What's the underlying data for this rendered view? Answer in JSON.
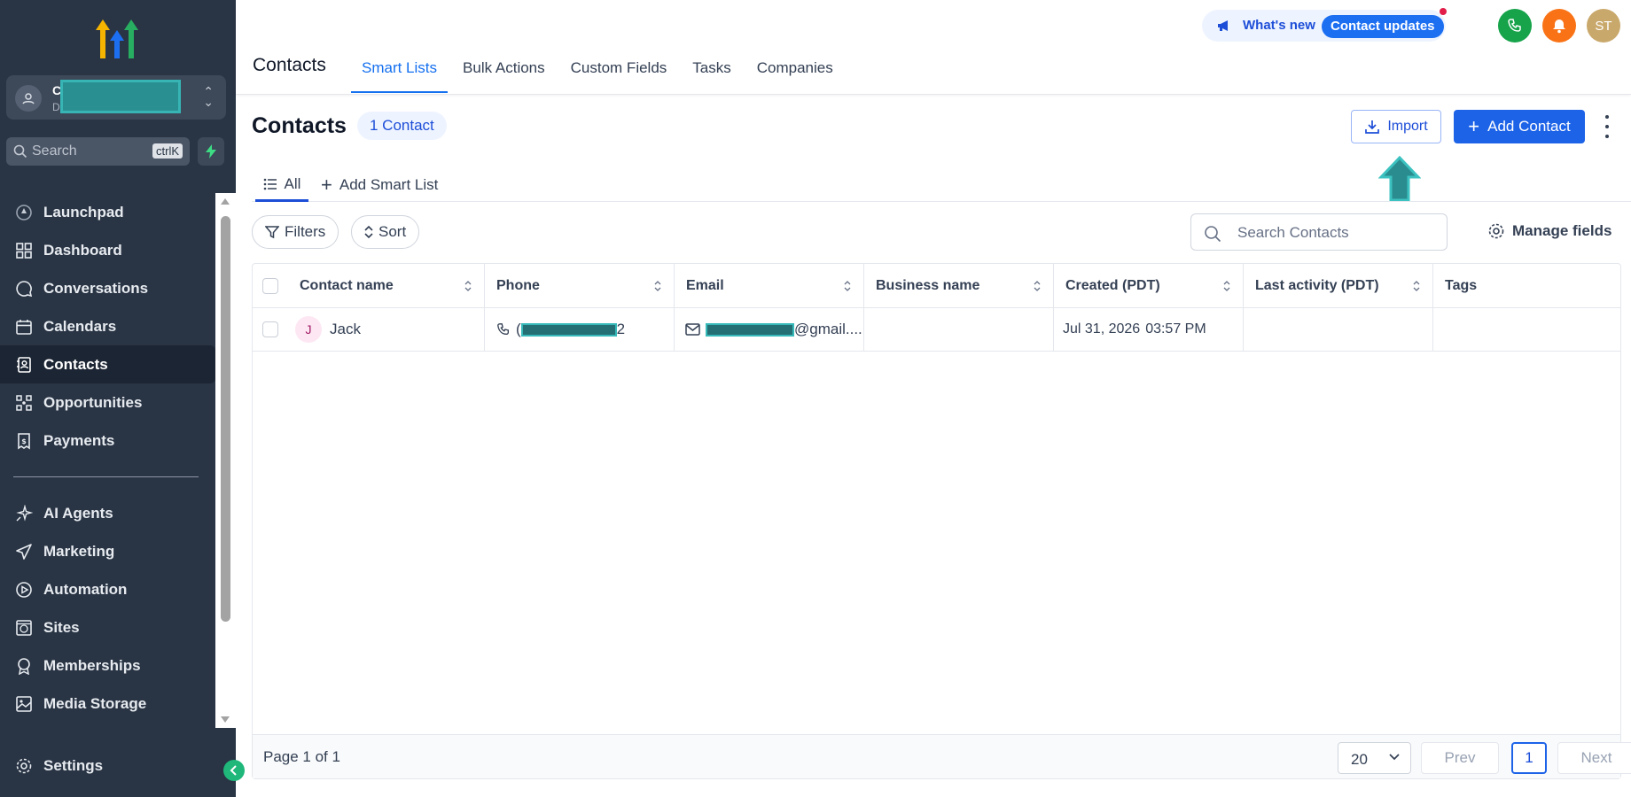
{
  "sidebar": {
    "account_initial": "C",
    "account_sub": "D",
    "search_placeholder": "Search",
    "search_shortcut": "ctrlK",
    "items": [
      {
        "label": "Launchpad",
        "icon": "launchpad-icon"
      },
      {
        "label": "Dashboard",
        "icon": "dashboard-icon"
      },
      {
        "label": "Conversations",
        "icon": "chat-icon"
      },
      {
        "label": "Calendars",
        "icon": "calendar-icon"
      },
      {
        "label": "Contacts",
        "icon": "contacts-icon",
        "active": true
      },
      {
        "label": "Opportunities",
        "icon": "opportunities-icon"
      },
      {
        "label": "Payments",
        "icon": "payments-icon"
      }
    ],
    "items2": [
      {
        "label": "AI Agents",
        "icon": "sparkle-icon"
      },
      {
        "label": "Marketing",
        "icon": "send-icon"
      },
      {
        "label": "Automation",
        "icon": "automation-icon"
      },
      {
        "label": "Sites",
        "icon": "globe-icon"
      },
      {
        "label": "Memberships",
        "icon": "award-icon"
      },
      {
        "label": "Media Storage",
        "icon": "image-icon"
      }
    ],
    "settings_label": "Settings"
  },
  "header": {
    "page_name": "Contacts",
    "tabs": [
      "Smart Lists",
      "Bulk Actions",
      "Custom Fields",
      "Tasks",
      "Companies"
    ],
    "active_tab": "Smart Lists",
    "whats_new": "What's new",
    "contact_updates": "Contact updates",
    "user_initials": "ST"
  },
  "content": {
    "title": "Contacts",
    "count_badge": "1 Contact",
    "import_label": "Import",
    "add_contact_label": "Add Contact",
    "smart_list_all": "All",
    "add_smart_list": "Add Smart List",
    "filters_label": "Filters",
    "sort_label": "Sort",
    "search_placeholder": "Search Contacts",
    "manage_fields": "Manage fields"
  },
  "table": {
    "columns": [
      "Contact name",
      "Phone",
      "Email",
      "Business name",
      "Created (PDT)",
      "Last activity (PDT)",
      "Tags"
    ],
    "rows": [
      {
        "initial": "J",
        "name": "Jack",
        "phone_prefix": "(",
        "phone_suffix": "2",
        "email_suffix": "@gmail....",
        "business": "",
        "created": "Jul 31, 2026",
        "created_time": "03:57 PM",
        "last_activity": "",
        "tags": ""
      }
    ]
  },
  "footer": {
    "page_info": "Page 1 of 1",
    "per_page": "20",
    "prev": "Prev",
    "current_page": "1",
    "next": "Next"
  },
  "colors": {
    "sidebar_bg": "#293444",
    "accent": "#1d63e8",
    "annotation": "#2a9d9f"
  }
}
